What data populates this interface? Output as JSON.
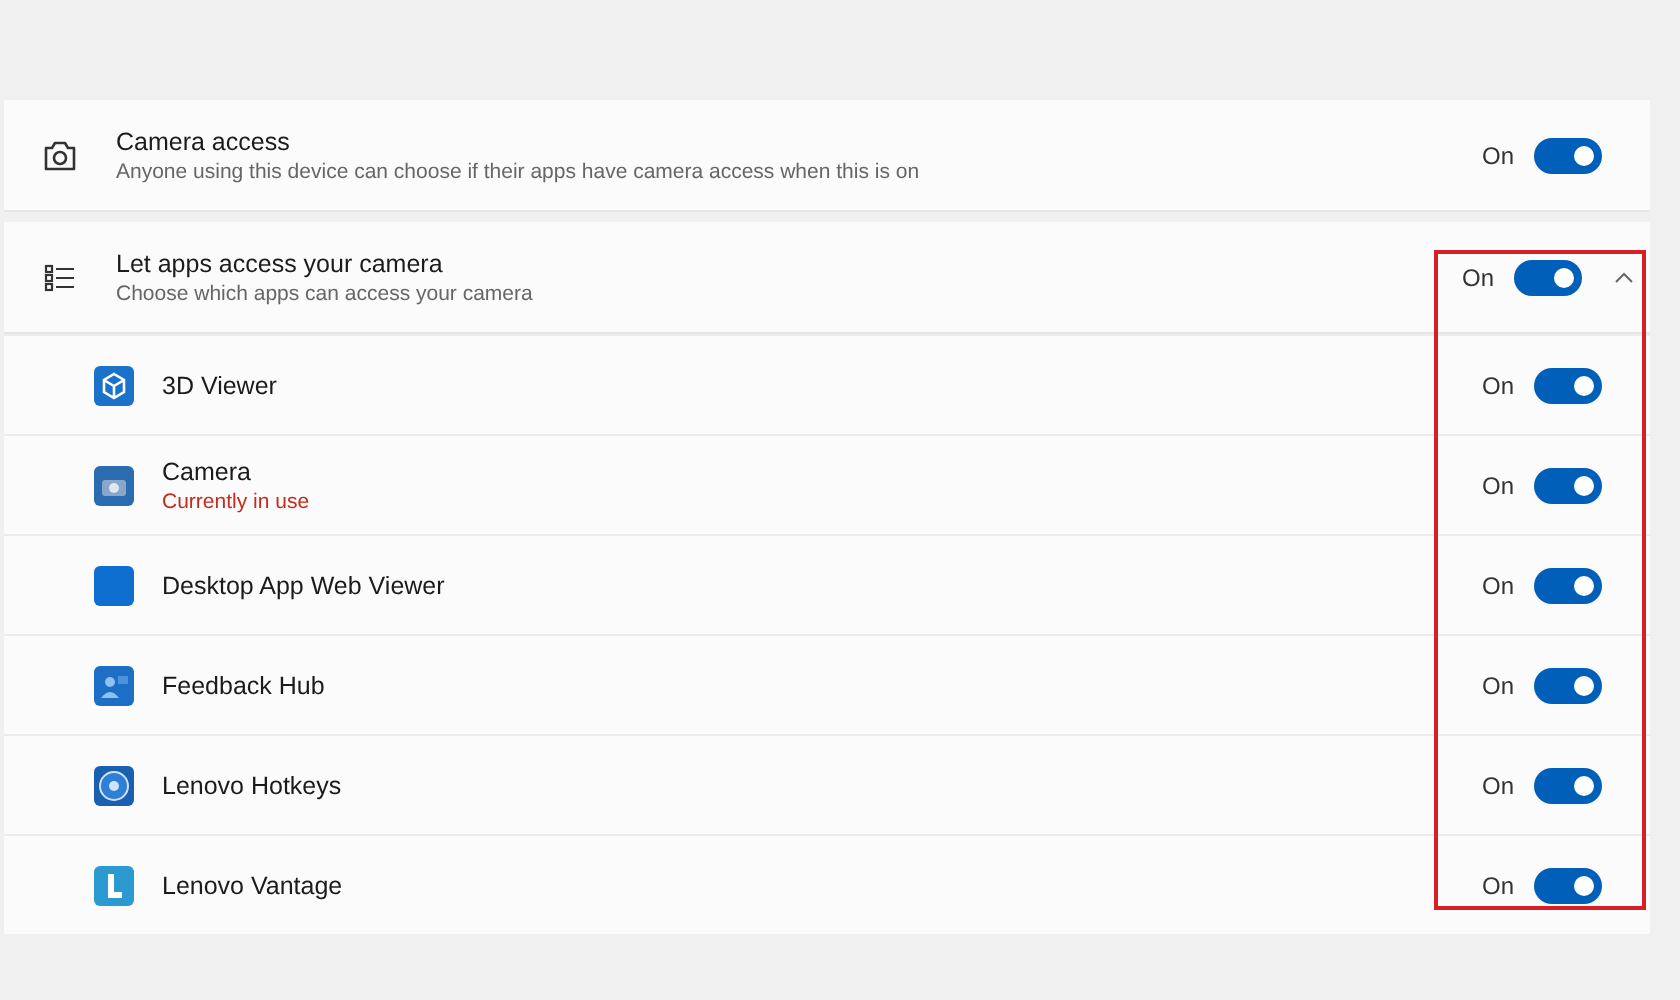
{
  "camera_access": {
    "title": "Camera access",
    "description": "Anyone using this device can choose if their apps have camera access when this is on",
    "toggle_label": "On",
    "on": true
  },
  "app_access": {
    "title": "Let apps access your camera",
    "description": "Choose which apps can access your camera",
    "toggle_label": "On",
    "on": true,
    "expanded": true,
    "apps": [
      {
        "name": "3D Viewer",
        "toggle_label": "On",
        "on": true
      },
      {
        "name": "Camera",
        "status": "Currently in use",
        "toggle_label": "On",
        "on": true
      },
      {
        "name": "Desktop App Web Viewer",
        "toggle_label": "On",
        "on": true
      },
      {
        "name": "Feedback Hub",
        "toggle_label": "On",
        "on": true
      },
      {
        "name": "Lenovo Hotkeys",
        "toggle_label": "On",
        "on": true
      },
      {
        "name": "Lenovo Vantage",
        "toggle_label": "On",
        "on": true
      }
    ]
  }
}
